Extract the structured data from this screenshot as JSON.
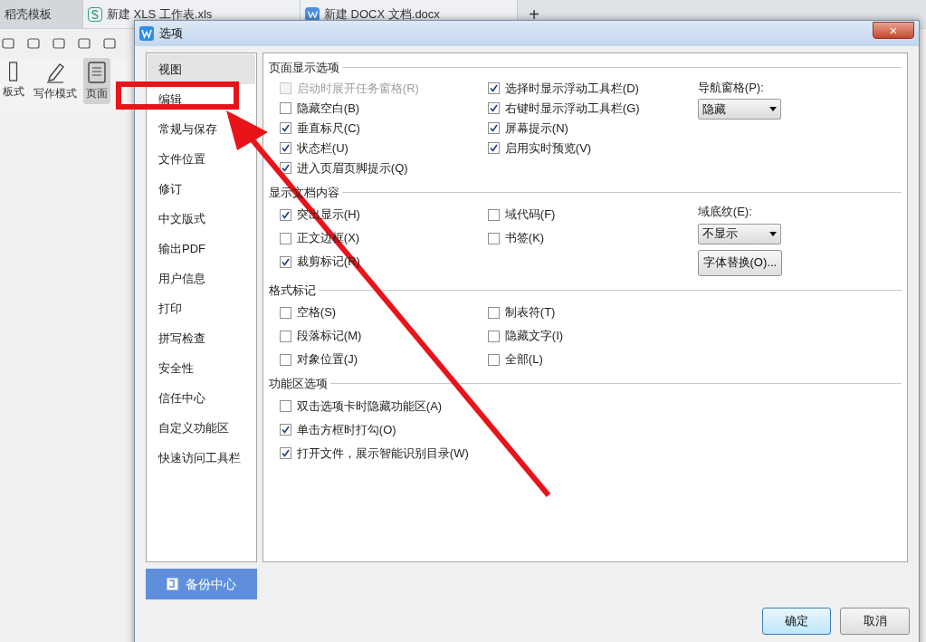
{
  "app_tabs": [
    {
      "label": "稻壳模板",
      "selected": true
    },
    {
      "label": "新建 XLS 工作表.xls",
      "selected": false
    },
    {
      "label": "新建 DOCX 文档.docx",
      "selected": false
    }
  ],
  "new_tab": "+",
  "toolbar_tools": [
    {
      "label": "板式",
      "selected": false
    },
    {
      "label": "写作模式",
      "selected": false
    },
    {
      "label": "页面",
      "selected": true
    }
  ],
  "dialog": {
    "title": "选项",
    "close": "×",
    "nav": [
      {
        "label": "视图",
        "selected": true
      },
      {
        "label": "编辑",
        "selected": false
      },
      {
        "label": "常规与保存",
        "selected": false
      },
      {
        "label": "文件位置",
        "selected": false
      },
      {
        "label": "修订",
        "selected": false
      },
      {
        "label": "中文版式",
        "selected": false
      },
      {
        "label": "输出PDF",
        "selected": false
      },
      {
        "label": "用户信息",
        "selected": false
      },
      {
        "label": "打印",
        "selected": false
      },
      {
        "label": "拼写检查",
        "selected": false
      },
      {
        "label": "安全性",
        "selected": false
      },
      {
        "label": "信任中心",
        "selected": false
      },
      {
        "label": "自定义功能区",
        "selected": false
      },
      {
        "label": "快速访问工具栏",
        "selected": false
      }
    ],
    "backup_button": "备份中心",
    "sections": [
      {
        "title": "页面显示选项",
        "columns": [
          [
            {
              "label": "启动时展开任务窗格(R)",
              "checked": false,
              "disabled": true
            },
            {
              "label": "隐藏空白(B)",
              "checked": false,
              "disabled": false
            },
            {
              "label": "垂直标尺(C)",
              "checked": true,
              "disabled": false
            },
            {
              "label": "状态栏(U)",
              "checked": true,
              "disabled": false
            },
            {
              "label": "进入页眉页脚提示(Q)",
              "checked": true,
              "disabled": false
            }
          ],
          [
            {
              "label": "选择时显示浮动工具栏(D)",
              "checked": true,
              "disabled": false
            },
            {
              "label": "右键时显示浮动工具栏(G)",
              "checked": true,
              "disabled": false
            },
            {
              "label": "屏幕提示(N)",
              "checked": true,
              "disabled": false
            },
            {
              "label": "启用实时预览(V)",
              "checked": true,
              "disabled": false
            }
          ]
        ],
        "side": [
          {
            "kind": "dropdown",
            "label": "导航窗格(P):",
            "value": "隐藏"
          }
        ]
      },
      {
        "title": "显示文档内容",
        "columns": [
          [
            {
              "label": "突出显示(H)",
              "checked": true,
              "disabled": false
            },
            {
              "label": "正文边框(X)",
              "checked": false,
              "disabled": false
            },
            {
              "label": "裁剪标记(R)",
              "checked": true,
              "disabled": false
            }
          ],
          [
            {
              "label": "域代码(F)",
              "checked": false,
              "disabled": false
            },
            {
              "label": "书签(K)",
              "checked": false,
              "disabled": false
            }
          ]
        ],
        "side": [
          {
            "kind": "dropdown",
            "label": "域底纹(E):",
            "value": "不显示"
          },
          {
            "kind": "button",
            "label": "字体替换(O)..."
          }
        ]
      },
      {
        "title": "格式标记",
        "columns": [
          [
            {
              "label": "空格(S)",
              "checked": false,
              "disabled": false
            },
            {
              "label": "段落标记(M)",
              "checked": false,
              "disabled": false
            },
            {
              "label": "对象位置(J)",
              "checked": false,
              "disabled": false
            }
          ],
          [
            {
              "label": "制表符(T)",
              "checked": false,
              "disabled": false
            },
            {
              "label": "隐藏文字(I)",
              "checked": false,
              "disabled": false
            },
            {
              "label": "全部(L)",
              "checked": false,
              "disabled": false
            }
          ]
        ]
      },
      {
        "title": "功能区选项",
        "columns": [
          [
            {
              "label": "双击选项卡时隐藏功能区(A)",
              "checked": false,
              "disabled": false
            },
            {
              "label": "单击方框时打勾(O)",
              "checked": true,
              "disabled": false
            },
            {
              "label": "打开文件，展示智能识别目录(W)",
              "checked": true,
              "disabled": false
            }
          ]
        ]
      }
    ],
    "ok": "确定",
    "cancel": "取消"
  }
}
